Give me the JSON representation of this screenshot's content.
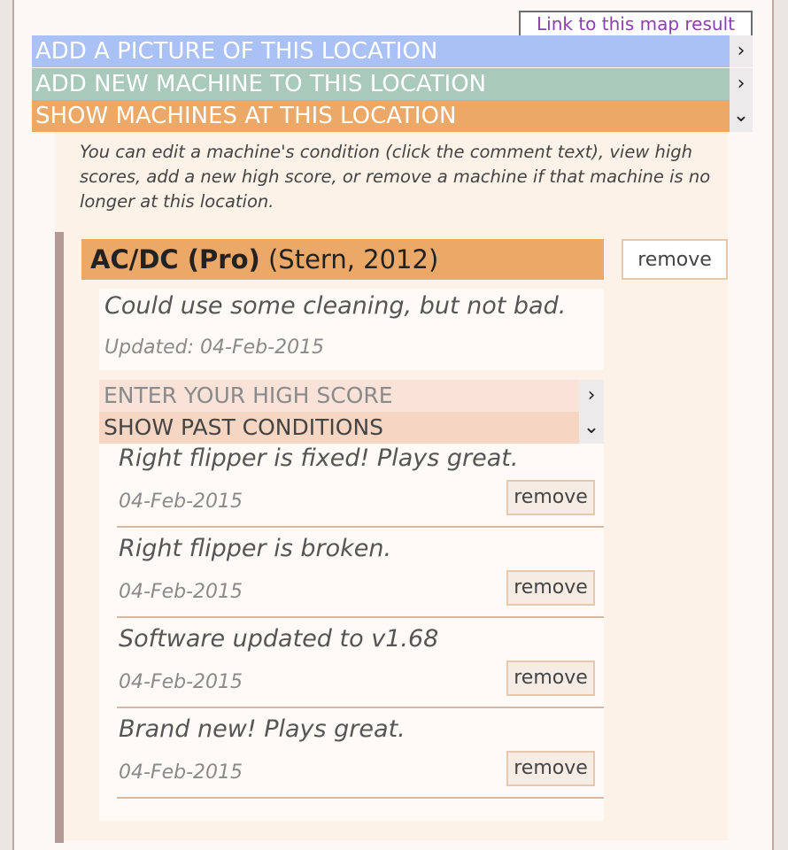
{
  "map_link": "Link to this map result",
  "bars": {
    "add_picture": "ADD A PICTURE OF THIS LOCATION",
    "add_machine": "ADD NEW MACHINE TO THIS LOCATION",
    "show_machines": "SHOW MACHINES AT THIS LOCATION"
  },
  "intro": "You can edit a machine's condition (click the comment text), view high scores, add a new high score, or remove a machine if that machine is no longer at this location.",
  "machine": {
    "name": "AC/DC (Pro)",
    "meta": "(Stern, 2012)",
    "remove_label": "remove",
    "condition": "Could use some cleaning, but not bad.",
    "updated": "Updated: 04-Feb-2015",
    "enter_score": "ENTER YOUR HIGH SCORE",
    "show_past": "SHOW PAST CONDITIONS",
    "past_conditions": [
      {
        "text": "Right flipper is fixed! Plays great.",
        "date": "04-Feb-2015",
        "remove": "remove"
      },
      {
        "text": "Right flipper is broken.",
        "date": "04-Feb-2015",
        "remove": "remove"
      },
      {
        "text": "Software updated to v1.68",
        "date": "04-Feb-2015",
        "remove": "remove"
      },
      {
        "text": "Brand new! Plays great.",
        "date": "04-Feb-2015",
        "remove": "remove"
      }
    ]
  },
  "icons": {
    "collapsed": "chevron-right",
    "expanded": "chevron-down"
  },
  "colors": {
    "blue_bar": "#a9c1f4",
    "green_bar": "#a9c9bb",
    "orange_bar": "#eba867",
    "link": "#8a3fae"
  }
}
